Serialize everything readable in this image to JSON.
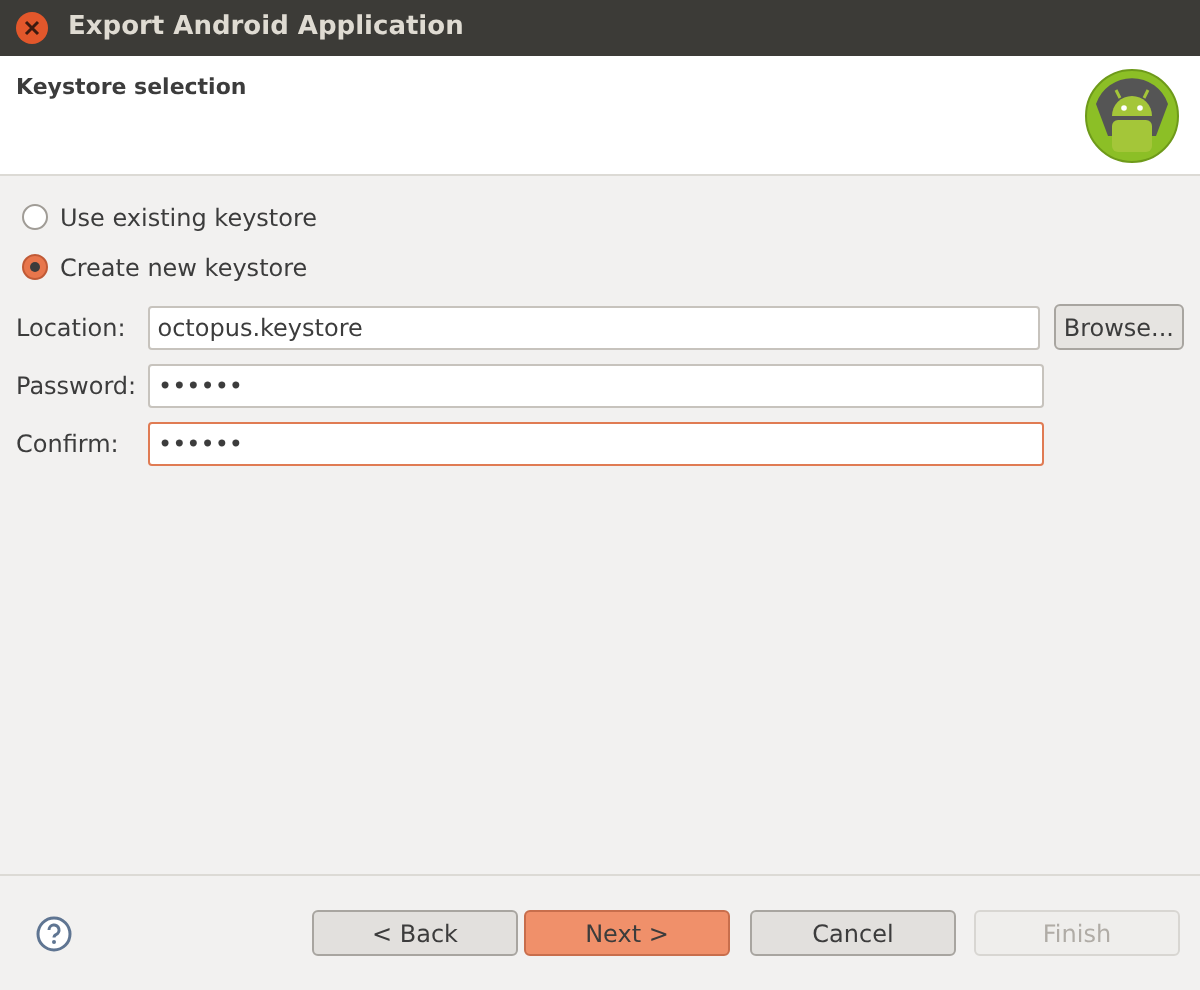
{
  "window": {
    "title": "Export Android Application"
  },
  "header": {
    "title": "Keystore selection"
  },
  "options": [
    {
      "label": "Use existing keystore",
      "selected": false
    },
    {
      "label": "Create new keystore",
      "selected": true
    }
  ],
  "fields": [
    {
      "label": "Location:",
      "value": "octopus.keystore",
      "focused": false,
      "button": "Browse..."
    },
    {
      "label": "Password:",
      "value": "••••••",
      "focused": false
    },
    {
      "label": "Confirm:",
      "value": "••••••",
      "focused": true
    }
  ],
  "buttons": [
    {
      "label": "< Back",
      "primary": false,
      "disabled": false
    },
    {
      "label": "Next >",
      "primary": true,
      "disabled": false
    },
    {
      "label": "Cancel",
      "primary": false,
      "disabled": false
    },
    {
      "label": "Finish",
      "primary": false,
      "disabled": true
    }
  ]
}
